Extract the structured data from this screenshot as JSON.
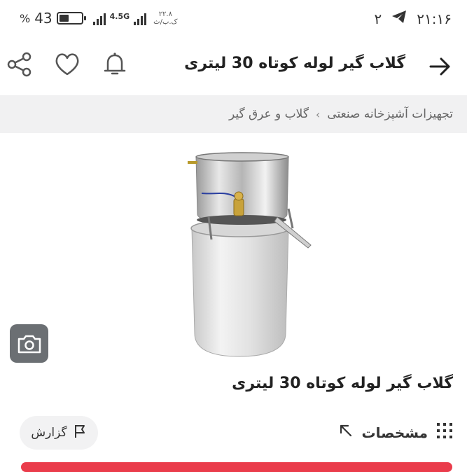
{
  "status_bar": {
    "battery_percent": "43",
    "percent_sign": "%",
    "network_type": "4.5G",
    "speed_value": "۲۲.۸",
    "speed_unit": "ک.ب/ث",
    "notification_count": "۲",
    "time": "۲۱:۱۶",
    "battery_level": 0.43
  },
  "app_bar": {
    "title": "گلاب گیر لوله کوتاه 30 لیتری"
  },
  "breadcrumb": {
    "items": [
      "تجهیزات آشپزخانه صنعتی",
      "گلاب و عرق گیر"
    ],
    "separator": "›"
  },
  "product": {
    "title": "گلاب گیر لوله کوتاه 30 لیتری",
    "specs_label": "مشخصات",
    "report_label": "گزارش"
  },
  "icons": {
    "back": "arrow-right-icon",
    "bell": "bell-icon",
    "heart": "heart-icon",
    "share": "share-icon",
    "camera": "camera-search-icon",
    "grid": "grid-dots-icon",
    "expand": "expand-arrow-icon",
    "flag": "flag-icon",
    "telegram": "telegram-icon"
  },
  "colors": {
    "accent": "#ea3c4b",
    "breadcrumb_bg": "#f1f1f2",
    "camera_bg": "#6b6f73"
  }
}
